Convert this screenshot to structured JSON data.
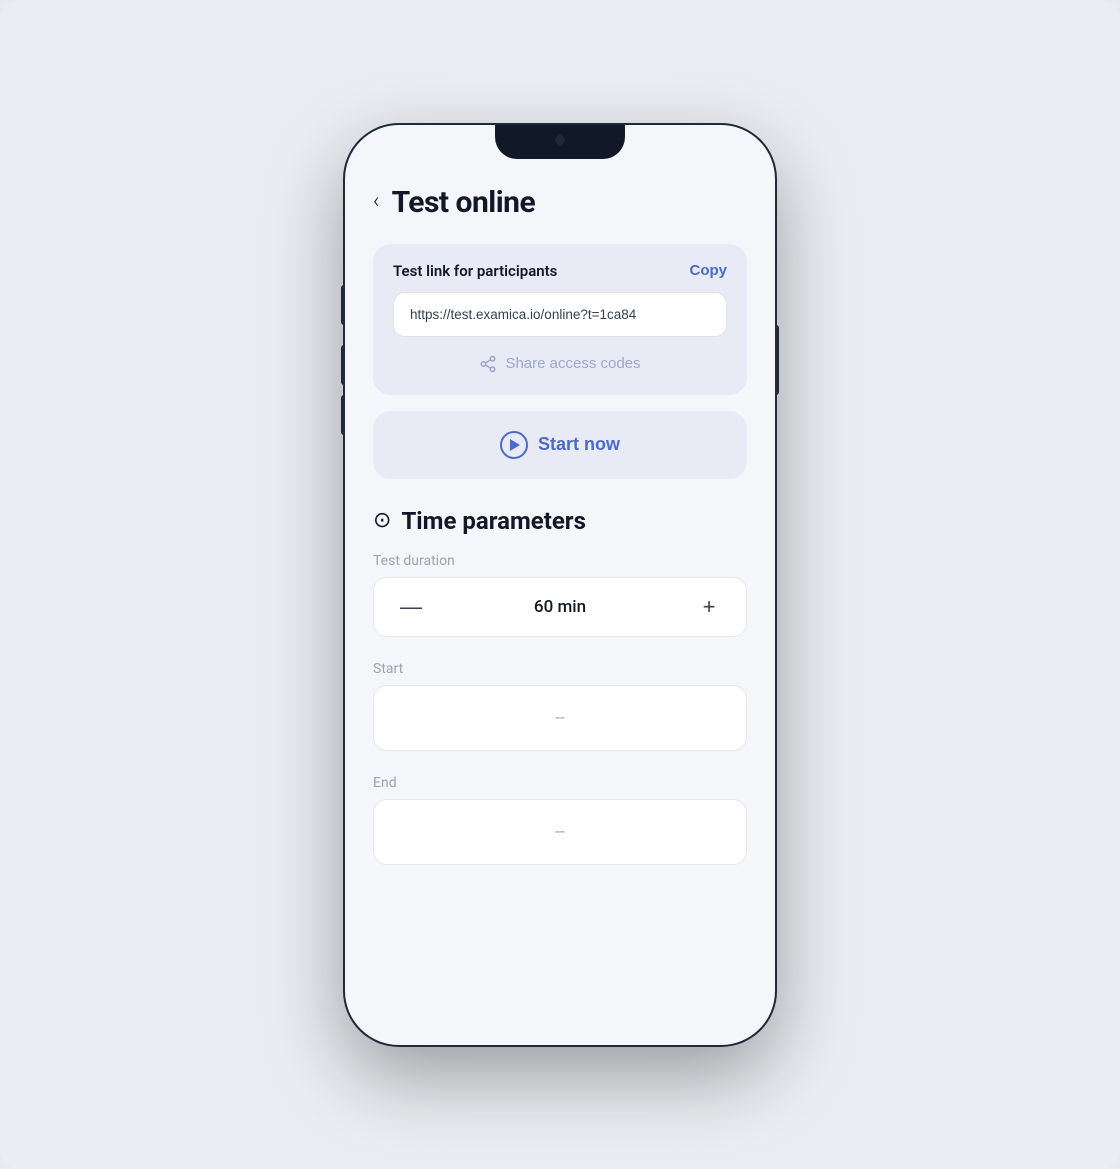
{
  "page": {
    "background_color": "#ebedf2"
  },
  "header": {
    "back_label": "‹",
    "title": "Test online"
  },
  "test_link_card": {
    "title": "Test link for participants",
    "copy_label": "Copy",
    "url_value": "https://test.examica.io/online?t=1ca84",
    "share_access_label": "Share access codes"
  },
  "start_now_button": {
    "label": "Start now"
  },
  "time_parameters": {
    "section_title": "Time parameters",
    "duration_label": "Test duration",
    "duration_value": "60 min",
    "start_label": "Start",
    "start_placeholder": "--",
    "end_label": "End",
    "end_placeholder": "--"
  },
  "icons": {
    "back": "‹",
    "play": "▶",
    "clock": "⊙",
    "share": "share",
    "minus": "—",
    "plus": "+"
  }
}
